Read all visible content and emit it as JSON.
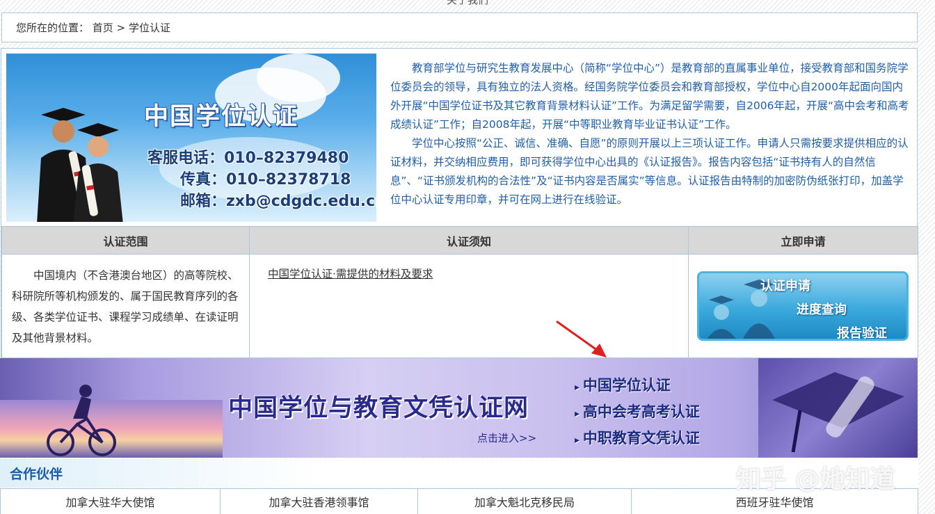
{
  "top_nav": {
    "cut_label": "关于我们"
  },
  "breadcrumb": {
    "prefix": "您所在的位置：",
    "home": "首页",
    "sep": ">",
    "current": "学位认证"
  },
  "hero": {
    "title": "中国学位认证",
    "phone": "客服电话：010–82379480",
    "fax": "传真：010–82378718",
    "email": "邮箱：zxb@cdgdc.edu.cn"
  },
  "intro": {
    "p1": "教育部学位与研究生教育发展中心（简称“学位中心”）是教育部的直属事业单位，接受教育部和国务院学位委员会的领导，具有独立的法人资格。经国务院学位委员会和教育部授权，学位中心自2000年起面向国内外开展“中国学位证书及其它教育背景材料认证”工作。为满足留学需要，自2006年起，开展“高中会考和高考成绩认证”工作；自2008年起，开展“中等职业教育毕业证书认证”工作。",
    "p2": "学位中心按照“公正、诚信、准确、自愿”的原则开展以上三项认证工作。申请人只需按要求提供相应的认证材料，并交纳相应费用，即可获得学位中心出具的《认证报告》。报告内容包括“证书持有人的自然信息”、“证书颁发机构的合法性”及“证书内容是否属实”等信息。认证报告由特制的加密防伪纸张打印，加盖学位中心认证专用印章，并可在网上进行在线验证。"
  },
  "table": {
    "headers": [
      "认证范围",
      "认证须知",
      "立即申请"
    ],
    "scope": "中国境内（不含港澳台地区）的高等院校、科研院所等机构颁发的、属于国民教育序列的各级、各类学位证书、课程学习成绩单、在读证明及其他背景材料。",
    "notice_link": "中国学位认证·需提供的材料及要求",
    "apply": {
      "line1": "认证申请",
      "line2": "进度查询",
      "line3": "报告验证"
    }
  },
  "banner": {
    "title": "中国学位与教育文凭认证网",
    "enter": "点击进入>>",
    "links": [
      "中国学位认证",
      "高中会考高考认证",
      "中职教育文凭认证"
    ]
  },
  "partners": {
    "title": "合作伙伴",
    "items": [
      "加拿大驻华大使馆",
      "加拿大驻香港领事馆",
      "加拿大魁北克移民局",
      "西班牙驻华使馆"
    ]
  },
  "watermark": "知乎 @她知道",
  "colors": {
    "link_blue": "#1f5fa8",
    "border": "#aac8e0",
    "header_gray": "#d8d8d8",
    "arrow_red": "#e02020"
  }
}
